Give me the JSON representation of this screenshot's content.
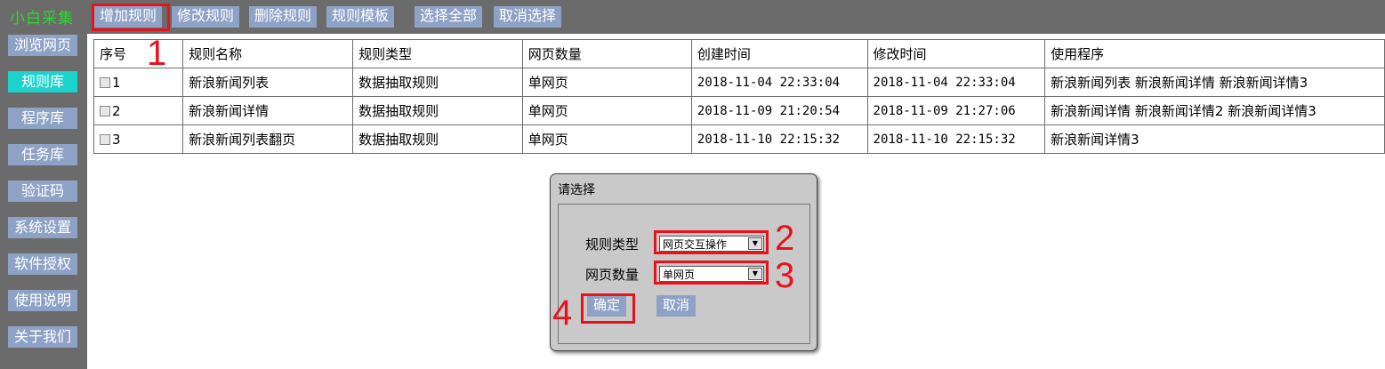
{
  "app": {
    "title": "小白采集"
  },
  "sidebar": {
    "items": [
      {
        "label": "浏览网页"
      },
      {
        "label": "规则库"
      },
      {
        "label": "程序库"
      },
      {
        "label": "任务库"
      },
      {
        "label": "验证码"
      },
      {
        "label": "系统设置"
      },
      {
        "label": "软件授权"
      },
      {
        "label": "使用说明"
      },
      {
        "label": "关于我们"
      }
    ],
    "active": "规则库"
  },
  "toolbar": {
    "buttons": [
      {
        "label": "增加规则"
      },
      {
        "label": "修改规则"
      },
      {
        "label": "删除规则"
      },
      {
        "label": "规则模板"
      },
      {
        "label": "选择全部"
      },
      {
        "label": "取消选择"
      }
    ]
  },
  "table": {
    "columns": [
      "序号",
      "规则名称",
      "规则类型",
      "网页数量",
      "创建时间",
      "修改时间",
      "使用程序"
    ],
    "rows": [
      {
        "id": "1",
        "name": "新浪新闻列表",
        "type": "数据抽取规则",
        "pages": "单网页",
        "created": "2018-11-04 22:33:04",
        "modified": "2018-11-04 22:33:04",
        "programs": "新浪新闻列表 新浪新闻详情 新浪新闻详情3"
      },
      {
        "id": "2",
        "name": "新浪新闻详情",
        "type": "数据抽取规则",
        "pages": "单网页",
        "created": "2018-11-09 21:20:54",
        "modified": "2018-11-09 21:27:06",
        "programs": "新浪新闻详情 新浪新闻详情2 新浪新闻详情3"
      },
      {
        "id": "3",
        "name": "新浪新闻列表翻页",
        "type": "数据抽取规则",
        "pages": "单网页",
        "created": "2018-11-10 22:15:32",
        "modified": "2018-11-10 22:15:32",
        "programs": "新浪新闻详情3"
      }
    ]
  },
  "dialog": {
    "title": "请选择",
    "rule_type_label": "规则类型",
    "rule_type_value": "网页交互操作",
    "page_count_label": "网页数量",
    "page_count_value": "单网页",
    "ok_label": "确定",
    "cancel_label": "取消"
  },
  "annotations": {
    "step1": "1",
    "step2": "2",
    "step3": "3",
    "step4": "4"
  },
  "colors": {
    "accent": "#8ea2c6",
    "active": "#1cd3cb",
    "highlight": "#e8121d",
    "title": "#2bdc2b",
    "background": "#6b6b6b"
  }
}
